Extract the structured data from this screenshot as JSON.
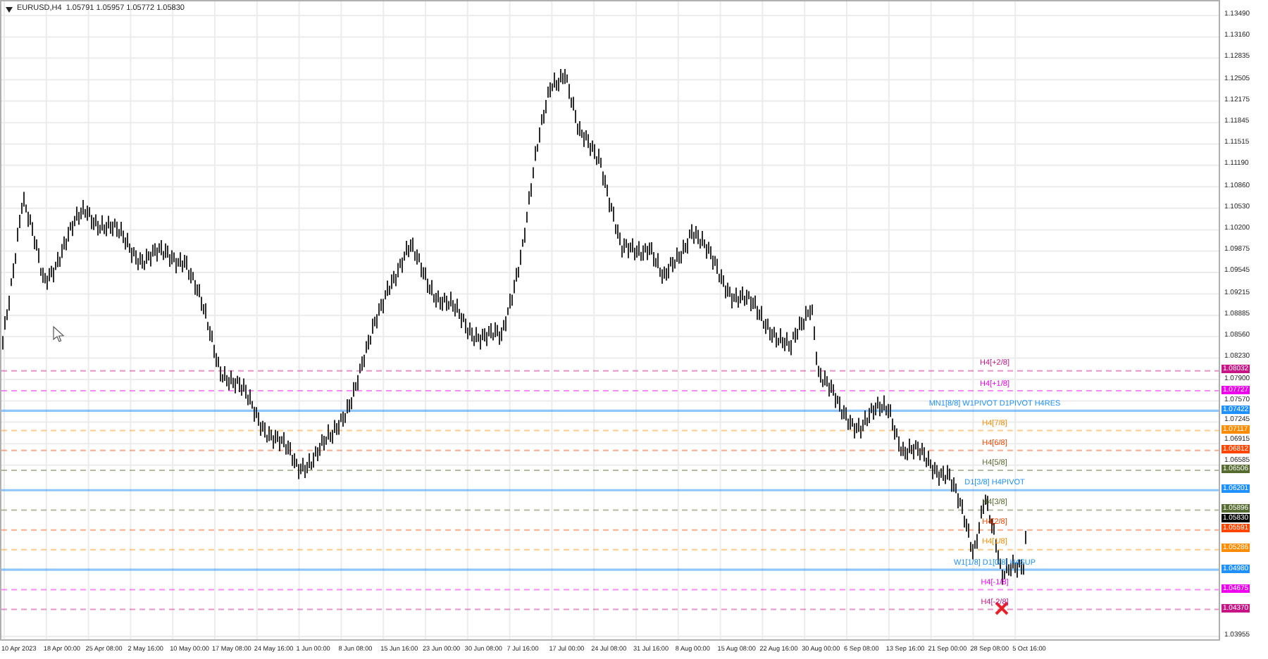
{
  "chart": {
    "title": "EURUSD,H4  1.05791 1.05957 1.05772 1.05830",
    "price_ticks": [
      "1.13490",
      "1.13160",
      "1.12835",
      "1.12505",
      "1.12175",
      "1.11845",
      "1.11515",
      "1.11190",
      "1.10860",
      "1.10530",
      "1.10200",
      "1.09875",
      "1.09545",
      "1.09215",
      "1.08885",
      "1.08560",
      "1.08230",
      "1.07900",
      "1.07570",
      "1.07245",
      "1.06915",
      "1.06585",
      "1.03955"
    ],
    "time_ticks": [
      "10 Apr 2023",
      "18 Apr 00:00",
      "25 Apr 08:00",
      "2 May 16:00",
      "10 May 00:00",
      "17 May 08:00",
      "24 May 16:00",
      "1 Jun 00:00",
      "8 Jun 08:00",
      "15 Jun 16:00",
      "23 Jun 00:00",
      "30 Jun 08:00",
      "7 Jul 16:00",
      "17 Jul 00:00",
      "24 Jul 08:00",
      "31 Jul 16:00",
      "8 Aug 00:00",
      "15 Aug 08:00",
      "22 Aug 16:00",
      "30 Aug 00:00",
      "6 Sep 08:00",
      "13 Sep 16:00",
      "21 Sep 00:00",
      "28 Sep 08:00",
      "5 Oct 16:00"
    ],
    "levels": [
      {
        "label": "H4[+2/8]",
        "price": "1.08032",
        "color": "#c71585",
        "kind": "dashed"
      },
      {
        "label": "H4[+1/8]",
        "price": "1.07727",
        "color": "#ee00ee",
        "kind": "dashed"
      },
      {
        "label": "MN1[8/8] W1PIVOT D1PIVOT H4RES",
        "price": "1.07422",
        "color": "#1e90ff",
        "kind": "solid"
      },
      {
        "label": "H4[7/8]",
        "price": "1.07117",
        "color": "#ff8c00",
        "kind": "dashed"
      },
      {
        "label": "H4[6/8]",
        "price": "1.06812",
        "color": "#ff4500",
        "kind": "dashed"
      },
      {
        "label": "H4[5/8]",
        "price": "1.06506",
        "color": "#556b2f",
        "kind": "dashed"
      },
      {
        "label": "D1[3/8] H4PIVOT",
        "price": "1.06201",
        "color": "#1e90ff",
        "kind": "solid"
      },
      {
        "label": "H4[3/8]",
        "price": "1.05896",
        "color": "#556b2f",
        "kind": "dashed"
      },
      {
        "label": "H4[2/8]",
        "price": "1.05591",
        "color": "#ff4500",
        "kind": "dashed"
      },
      {
        "label": "H4[1/8]",
        "price": "1.05286",
        "color": "#ff8c00",
        "kind": "dashed"
      },
      {
        "label": "W1[1/8] D1[0/8] H4SUP",
        "price": "1.04980",
        "color": "#1e90ff",
        "kind": "solid"
      },
      {
        "label": "H4[-1/8]",
        "price": "1.04675",
        "color": "#ee00ee",
        "kind": "dashed"
      },
      {
        "label": "H4[-2/8]",
        "price": "1.04370",
        "color": "#c71585",
        "kind": "dashed"
      }
    ],
    "current_price": "1.05830"
  }
}
